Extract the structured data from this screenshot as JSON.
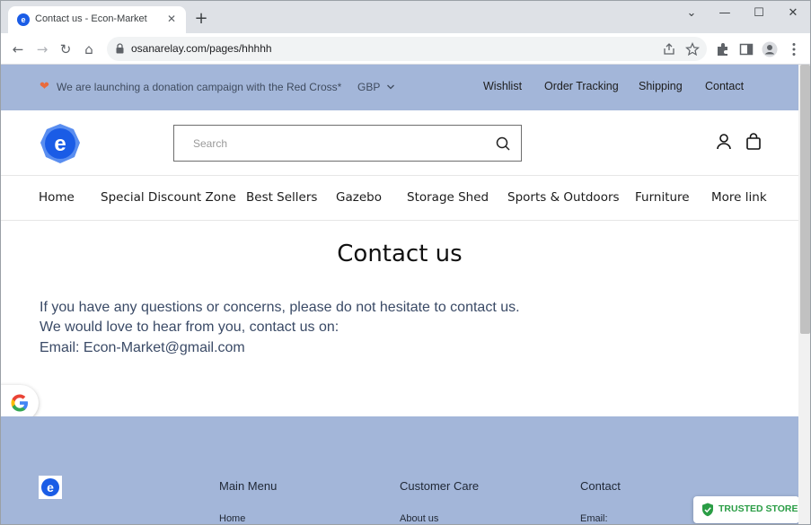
{
  "browser": {
    "tab_title": "Contact us - Econ-Market",
    "tab_close": "✕",
    "new_tab": "+",
    "url": "osanarelay.com/pages/hhhhh",
    "window_controls": {
      "chevron": "⌄",
      "minimize": "—",
      "maximize": "☐",
      "close": "✕"
    },
    "nav_icons": {
      "back": "←",
      "forward": "→",
      "reload": "↻",
      "home": "⌂"
    },
    "toolbar_icons": [
      "share-icon",
      "star-icon",
      "extensions-icon",
      "side-panel-icon",
      "profile-icon",
      "menu-icon"
    ]
  },
  "announcement": {
    "message": "We are launching a donation campaign with the Red Cross*",
    "currency": "GBP",
    "links": [
      "Wishlist",
      "Order Tracking",
      "Shipping",
      "Contact"
    ],
    "heart_color": "#e96b3c"
  },
  "header": {
    "search_placeholder": "Search",
    "search_value": "",
    "brand_color": "#1a5ce6"
  },
  "nav": {
    "items": [
      "Home",
      "Special Discount Zone",
      "Best Sellers",
      "Gazebo",
      "Storage Shed",
      "Sports & Outdoors",
      "Furniture",
      "More link"
    ]
  },
  "main": {
    "title": "Contact us",
    "lines": [
      "If you have any questions or concerns, please do not hesitate to contact us.",
      "We would love to hear from you, contact us on:",
      "Email: Econ-Market@gmail.com"
    ]
  },
  "footer": {
    "columns": [
      {
        "heading": "Main Menu",
        "first_link": "Home"
      },
      {
        "heading": "Customer Care",
        "first_link": "About us"
      },
      {
        "heading": "Contact",
        "first_link": "Email:"
      }
    ],
    "background": "#a3b6d9"
  },
  "badge": {
    "label": "TRUSTED STORE",
    "color": "#2a9d45"
  }
}
